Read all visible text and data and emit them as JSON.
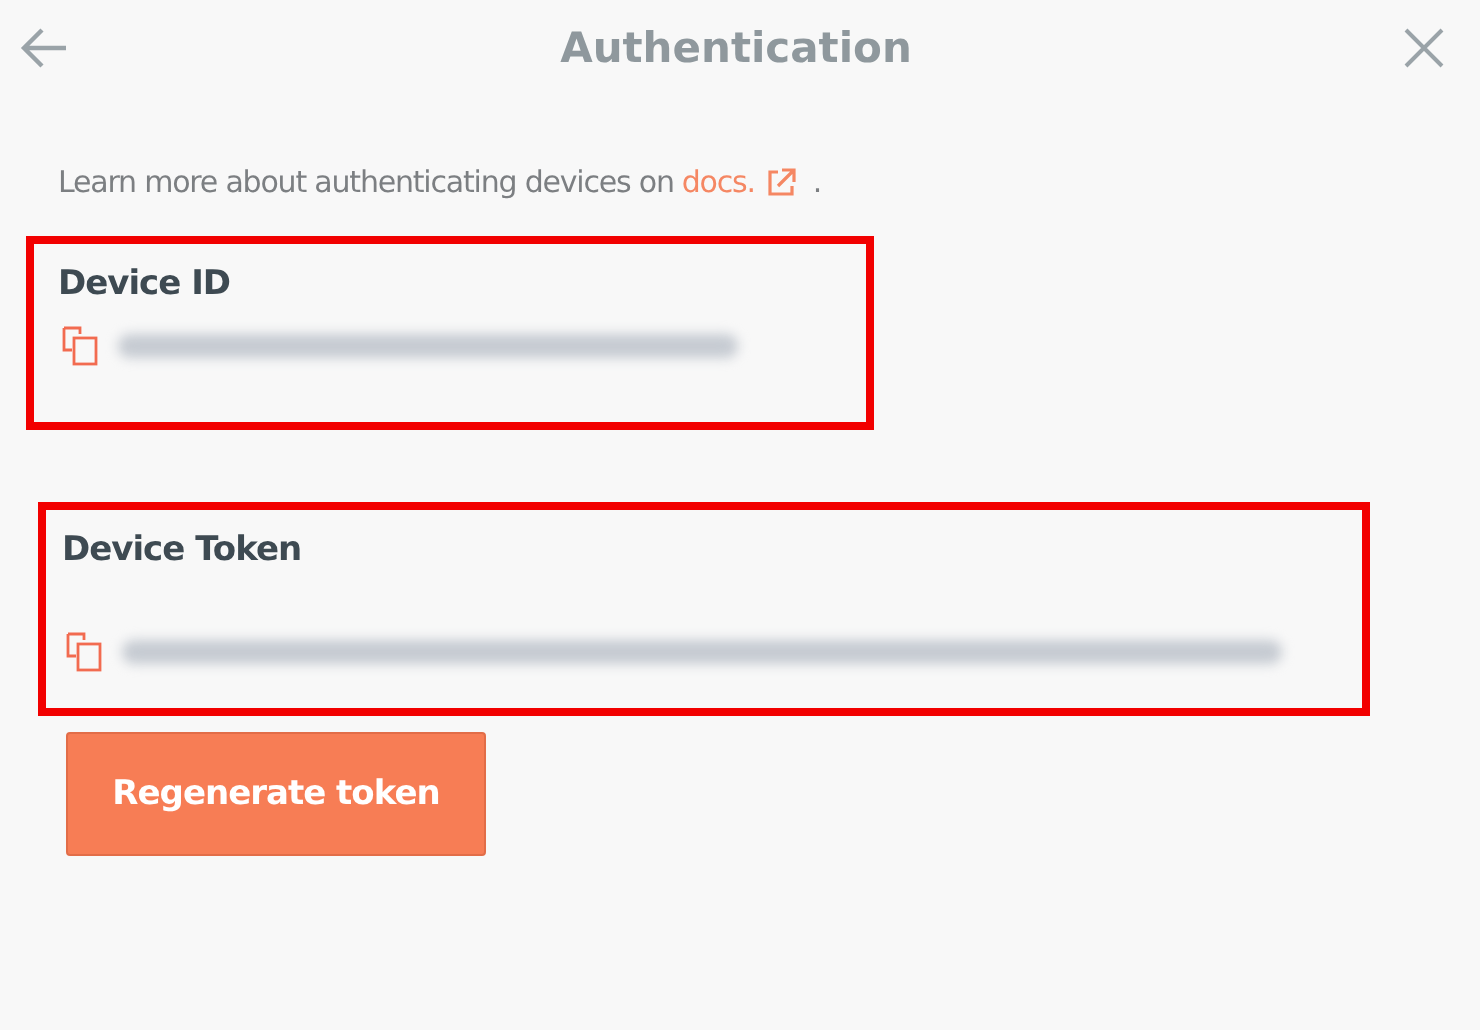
{
  "header": {
    "title": "Authentication"
  },
  "intro": {
    "text": "Learn more about authenticating devices on",
    "link": "docs.",
    "after": "."
  },
  "fields": [
    {
      "label": "Device ID",
      "redacted": true,
      "highlighted": true
    },
    {
      "label": "Device Token",
      "redacted": true,
      "highlighted": true
    }
  ],
  "button": "Regenerate token"
}
